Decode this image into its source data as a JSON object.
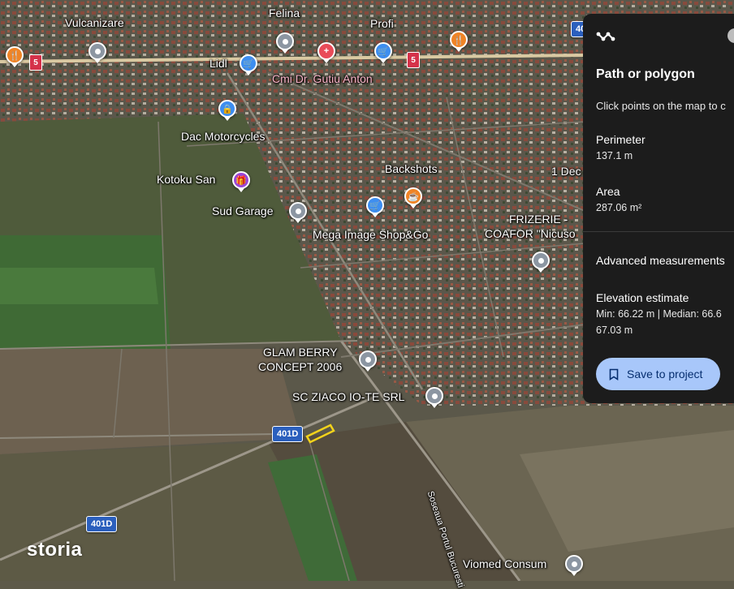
{
  "map": {
    "places": {
      "vulcanizare": "Vulcanizare",
      "felina": "Felina",
      "profi": "Profi",
      "lidl": "Lidl",
      "cmi": "Cmi Dr. Gutiu Anton",
      "dac": "Dac Motorcycles",
      "kotoku": "Kotoku San",
      "backshots": "Backshots",
      "dec": "1 Dec",
      "sud_garage": "Sud Garage",
      "frizerie_1": "FRIZERIE -",
      "frizerie_2": "COAFOR \"Nicuso",
      "mega": "Mega Image Shop&Go",
      "glam_1": "GLAM BERRY",
      "glam_2": "CONCEPT 2006",
      "ziaco": "SC ZIACO IO-TE SRL",
      "soseaua": "Soseaua Portul Bucuresti",
      "viomed": "Viomed Consum"
    },
    "road_shields": [
      "401D",
      "401D"
    ],
    "route_markers": [
      "5",
      "5"
    ],
    "top_edge_shield": "40",
    "watermark": "storia"
  },
  "panel": {
    "title": "Path or polygon",
    "instruction": "Click points on the map to c",
    "perimeter_label": "Perimeter",
    "perimeter_value": "137.1 m",
    "area_label": "Area",
    "area_value": "287.06 m²",
    "advanced_label": "Advanced measurements",
    "elevation_label": "Elevation estimate",
    "elevation_line1": "Min: 66.22 m | Median: 66.6",
    "elevation_line2": "67.03 m",
    "save_button": "Save to project"
  },
  "colors": {
    "panel_bg": "#1c1c1c",
    "save_button_bg": "#a8c7fa",
    "highway_shield": "#2b5fbd",
    "poi_blue": "#3d8ef0",
    "poi_orange": "#f08426",
    "poi_red": "#e94b58",
    "poi_purple": "#9a46d6",
    "poi_grey": "#8c96a2",
    "measured_polygon": "#f2d21b"
  }
}
